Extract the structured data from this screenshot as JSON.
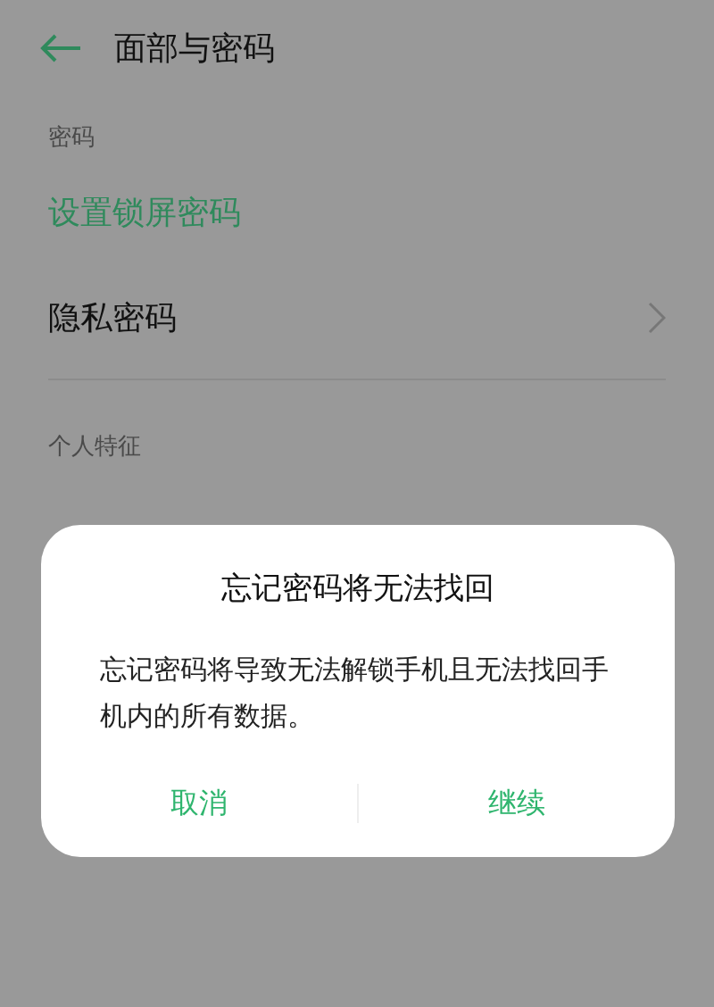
{
  "header": {
    "title": "面部与密码"
  },
  "sections": [
    {
      "header": "密码",
      "items": [
        {
          "label": "设置锁屏密码",
          "kind": "action"
        },
        {
          "label": "隐私密码",
          "kind": "nav"
        }
      ]
    },
    {
      "header": "个人特征"
    }
  ],
  "dialog": {
    "title": "忘记密码将无法找回",
    "message": "忘记密码将导致无法解锁手机且无法找回手机内的所有数据。",
    "buttons": [
      {
        "label": "取消"
      },
      {
        "label": "继续"
      }
    ]
  }
}
